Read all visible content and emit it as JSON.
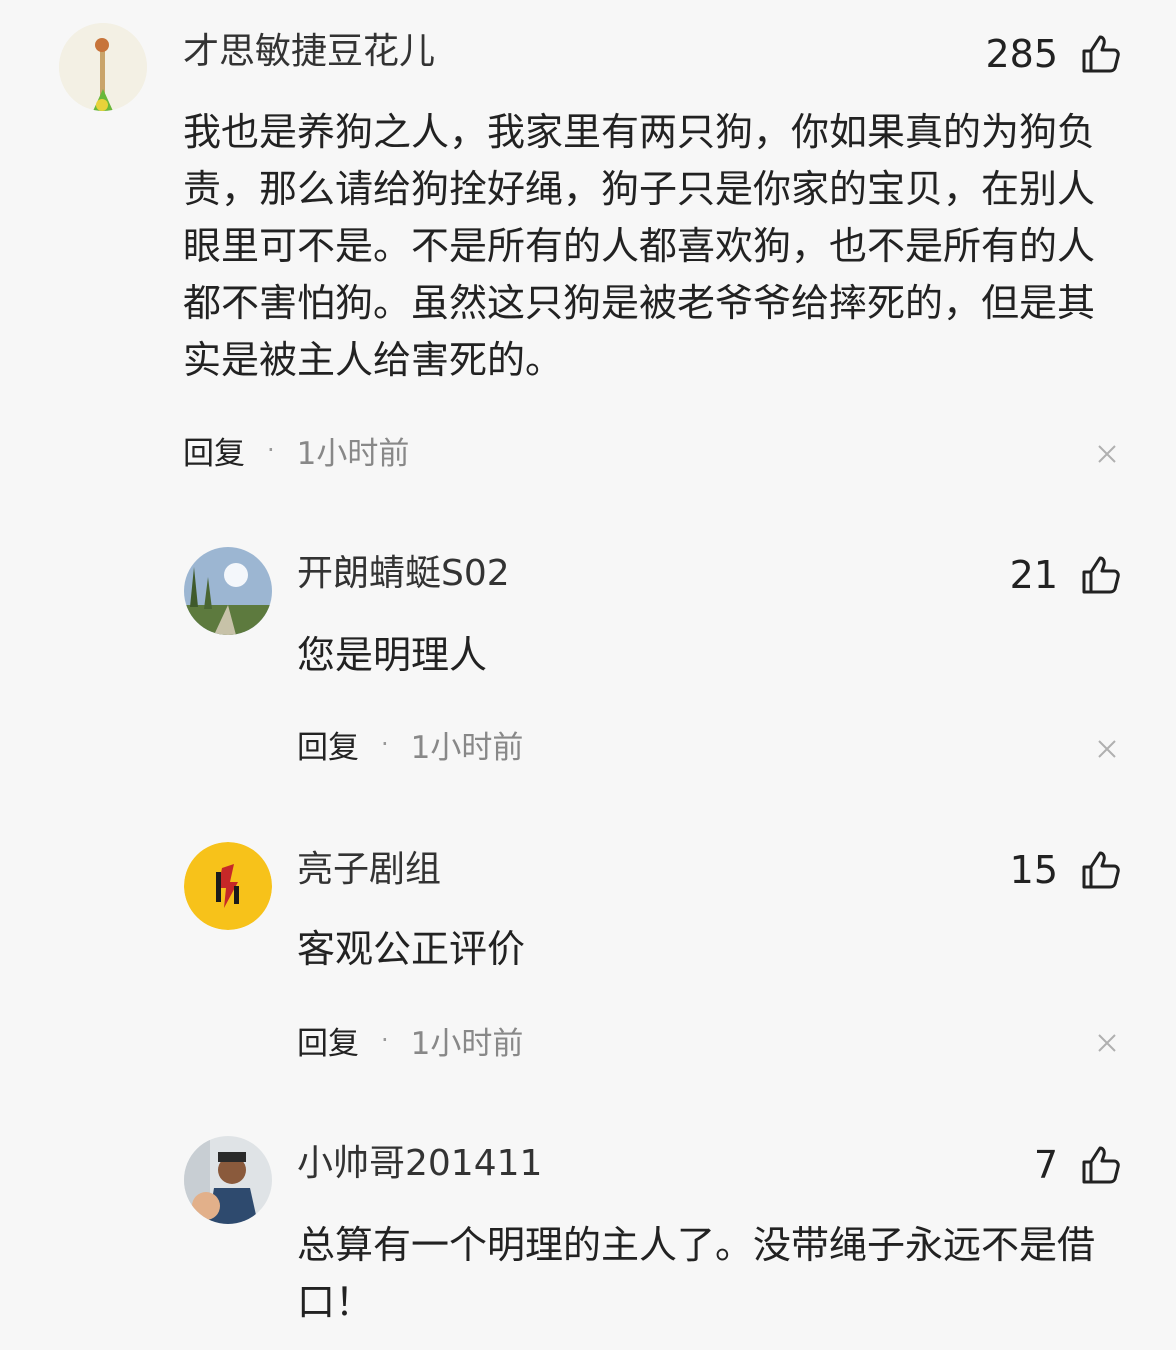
{
  "comments": [
    {
      "author": "才思敏捷豆花儿",
      "likes": "285",
      "text": "我也是养狗之人，我家里有两只狗，你如果真的为狗负责，那么请给狗拴好绳，狗子只是你家的宝贝，在别人眼里可不是。不是所有的人都喜欢狗，也不是所有的人都不害怕狗。虽然这只狗是被老爷爷给摔死的，但是其实是被主人给害死的。",
      "reply_label": "回复",
      "time": "1小时前"
    },
    {
      "author": "开朗蜻蜓S02",
      "likes": "21",
      "text": "您是明理人",
      "reply_label": "回复",
      "time": "1小时前"
    },
    {
      "author": "亮子剧组",
      "likes": "15",
      "text": "客观公正评价",
      "reply_label": "回复",
      "time": "1小时前"
    },
    {
      "author": "小帅哥201411",
      "likes": "7",
      "text": "总算有一个明理的主人了。没带绳子永远不是借口！"
    }
  ],
  "icons": {
    "like": "thumbs-up-icon",
    "close": "close-icon"
  },
  "colors": {
    "background": "#f7f7f7",
    "text": "#222222",
    "muted": "#888888",
    "avatar_yellow": "#f7c21a"
  }
}
